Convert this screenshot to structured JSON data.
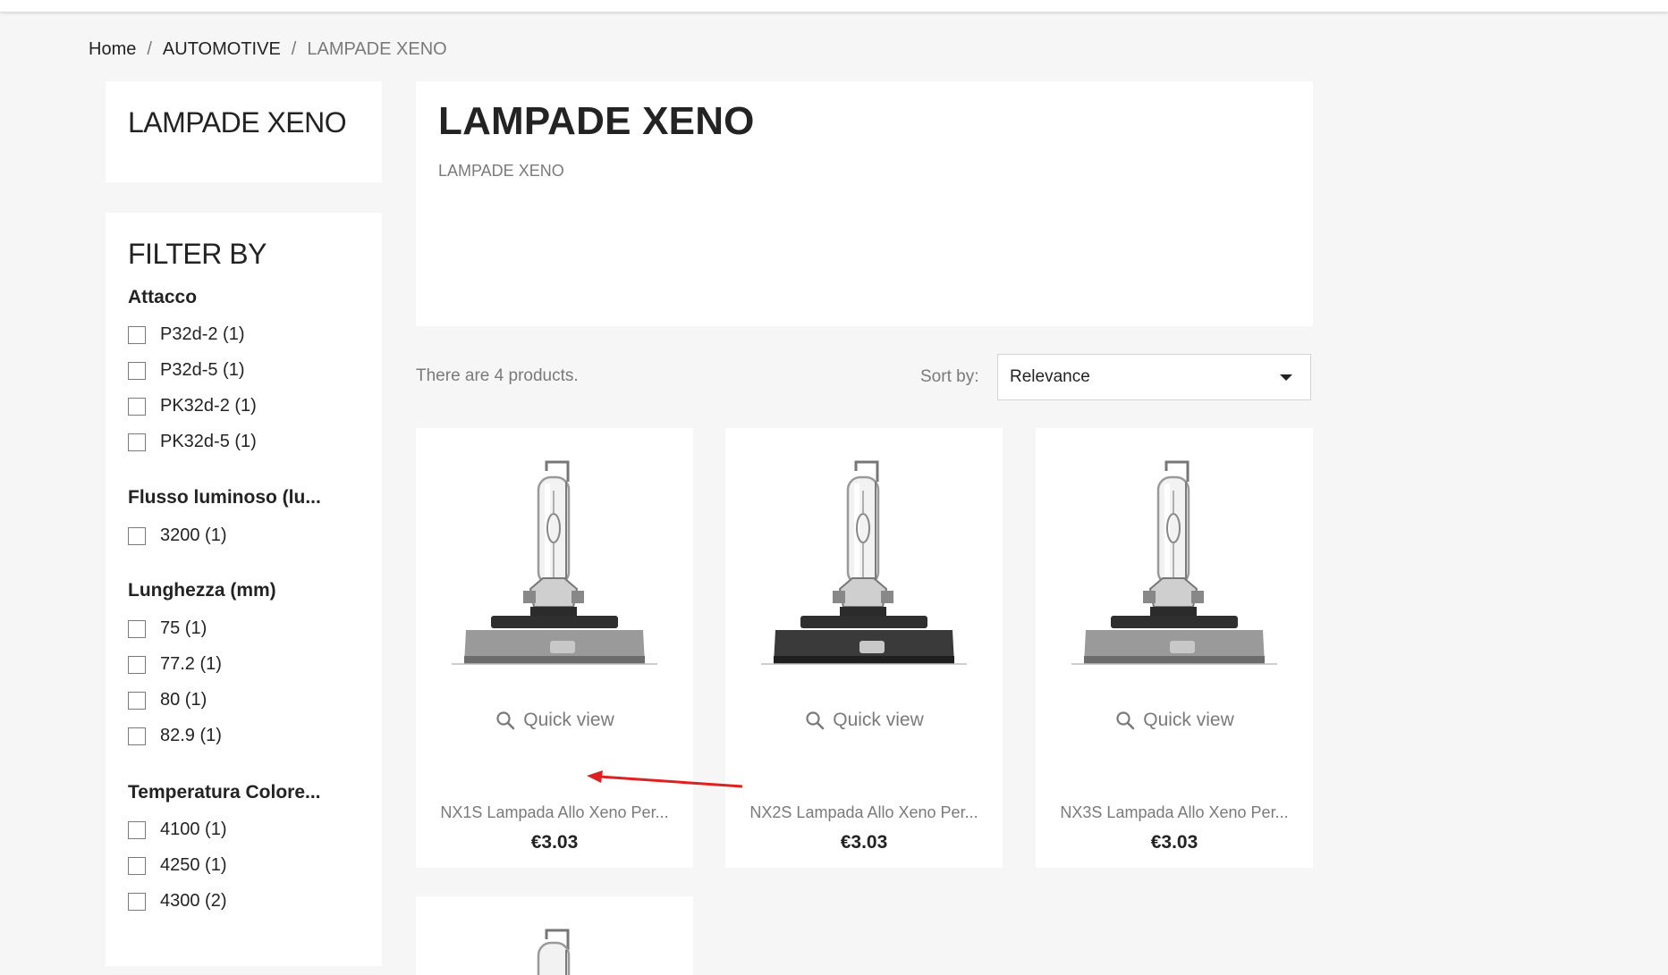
{
  "breadcrumb": {
    "home": "Home",
    "category": "AUTOMOTIVE",
    "current": "LAMPADE XENO",
    "separator": "/"
  },
  "sidebar": {
    "category_title": "LAMPADE XENO",
    "filter_heading": "FILTER BY",
    "facets": [
      {
        "title": "Attacco",
        "items": [
          "P32d-2 (1)",
          "P32d-5 (1)",
          "PK32d-2 (1)",
          "PK32d-5 (1)"
        ]
      },
      {
        "title": "Flusso luminoso (lu...",
        "items": [
          "3200 (1)"
        ]
      },
      {
        "title": "Lunghezza (mm)",
        "items": [
          "75 (1)",
          "77.2 (1)",
          "80 (1)",
          "82.9 (1)"
        ]
      },
      {
        "title": "Temperatura Colore...",
        "items": [
          "4100 (1)",
          "4250 (1)",
          "4300 (2)"
        ]
      }
    ]
  },
  "header": {
    "title": "LAMPADE XENO",
    "description": "LAMPADE XENO"
  },
  "listing": {
    "count_text": "There are 4 products.",
    "sort_label": "Sort by:",
    "sort_value": "Relevance",
    "quick_view_label": "Quick view",
    "products": [
      {
        "name": "NX1S Lampada Allo Xeno Per...",
        "price": "€3.03",
        "base": "silver"
      },
      {
        "name": "NX2S Lampada Allo Xeno Per...",
        "price": "€3.03",
        "base": "black"
      },
      {
        "name": "NX3S Lampada Allo Xeno Per...",
        "price": "€3.03",
        "base": "silver"
      }
    ]
  },
  "colors": {
    "annotation_arrow": "#e02020",
    "text_primary": "#232323",
    "text_muted": "#7a7a7a"
  }
}
